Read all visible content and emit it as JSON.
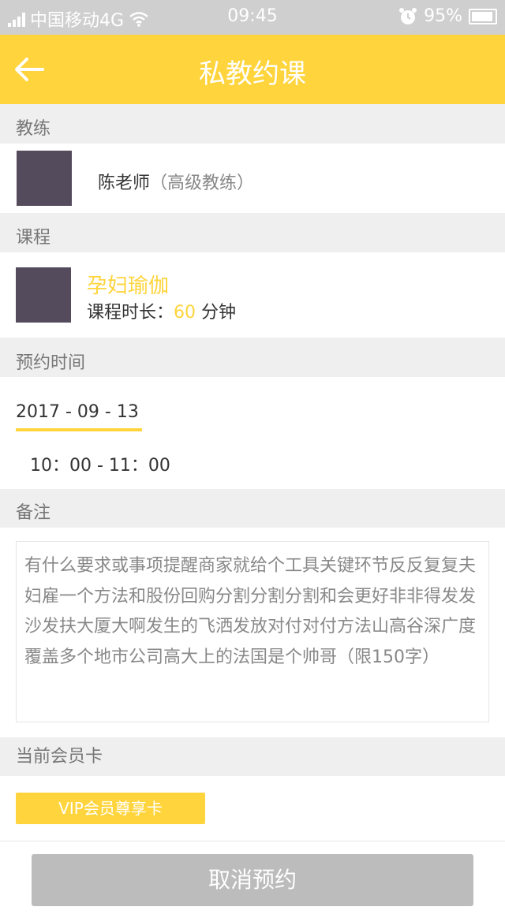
{
  "status_bar": {
    "carrier": "中国移动4G",
    "time": "09:45",
    "battery": "95%"
  },
  "header": {
    "title": "私教约课",
    "back_icon": "arrow-left-icon"
  },
  "coach": {
    "section_label": "教练",
    "name": "陈老师",
    "level": "（高级教练）"
  },
  "course": {
    "section_label": "课程",
    "name": "孕妇瑜伽",
    "duration_label": "课程时长：",
    "duration_value": "60",
    "duration_unit": " 分钟"
  },
  "booking_time": {
    "section_label": "预约时间",
    "date": "2017 - 09 - 13",
    "time_range": "10：00 - 11：00"
  },
  "remarks": {
    "section_label": "备注",
    "text": "有什么要求或事项提醒商家就给个工具关键环节反反复复夫妇雇一个方法和股份回购分割分割分割和会更好非非得发发沙发扶大厦大啊发生的飞洒发放对付对付方法山高谷深广度覆盖多个地市公司高大上的法国是个帅哥（限150字）"
  },
  "membership_card": {
    "section_label": "当前会员卡",
    "card_name": "VIP会员尊享卡"
  },
  "footer": {
    "cancel_label": "取消预约"
  },
  "colors": {
    "accent": "#ffd43c",
    "avatar_placeholder": "#544c5c",
    "button_disabled": "#bcbcbc"
  }
}
